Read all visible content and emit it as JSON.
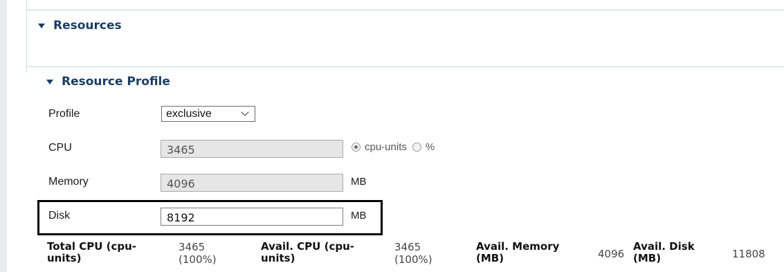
{
  "sections": {
    "resources": {
      "title": "Resources"
    },
    "resource_profile": {
      "title": "Resource Profile"
    }
  },
  "profile": {
    "label": "Profile",
    "selected": "exclusive"
  },
  "cpu": {
    "label": "CPU",
    "value": "3465",
    "unit_options": [
      {
        "label": "cpu-units",
        "checked": true
      },
      {
        "label": "%",
        "checked": false
      }
    ]
  },
  "memory": {
    "label": "Memory",
    "value": "4096",
    "unit": "MB"
  },
  "disk": {
    "label": "Disk",
    "value": "8192",
    "unit": "MB"
  },
  "summary": {
    "total_cpu": {
      "label_line1": "Total CPU (cpu-",
      "label_line2": "units)",
      "value_line1": "3465",
      "value_line2": "(100%)"
    },
    "avail_cpu": {
      "label_line1": "Avail. CPU (cpu-",
      "label_line2": "units)",
      "value_line1": "3465",
      "value_line2": "(100%)"
    },
    "avail_memory": {
      "label_line1": "Avail. Memory",
      "label_line2": "(MB)",
      "value": "4096"
    },
    "avail_disk": {
      "label_line1": "Avail. Disk",
      "label_line2": "(MB)",
      "value": "11808"
    }
  },
  "colors": {
    "section_header": "#1b3e63",
    "readonly_field_bg": "#e6e6e6",
    "highlight_border": "#000000"
  }
}
